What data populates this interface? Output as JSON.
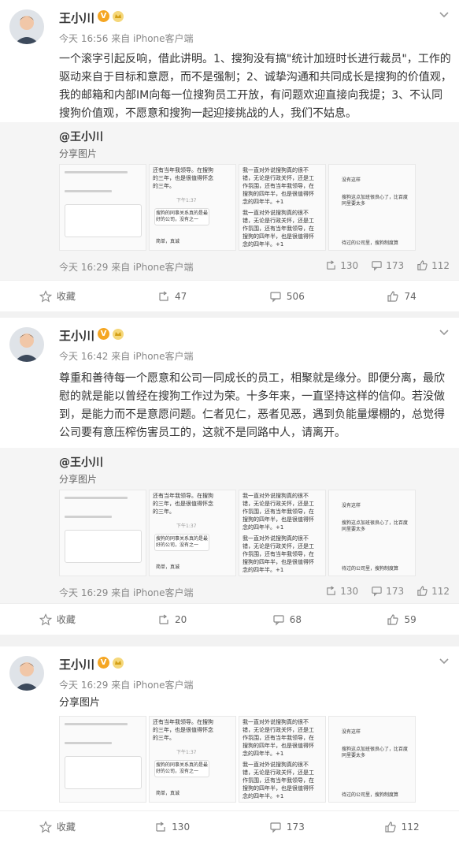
{
  "posts": [
    {
      "user": "王小川",
      "meta": "今天 16:56 来自 iPhone客户端",
      "text": "一个滚字引起反响，借此讲明。1、搜狗没有搞\"统计加班时长进行裁员\"，工作的驱动来自于目标和意愿，而不是强制；2、诚挚沟通和共同成长是搜狗的价值观，我的邮箱和内部IM向每一位搜狗员工开放，有问题欢迎直接向我提；3、不认同搜狗价值观，不愿意和搜狗一起迎接挑战的人，我们不姑息。",
      "repost": {
        "author": "@王小川",
        "share": "分享图片",
        "meta": "今天 16:29 来自 iPhone客户端",
        "forward": "130",
        "comment": "173",
        "like": "112"
      },
      "actions": {
        "fav": "收藏",
        "forward": "47",
        "comment": "506",
        "like": "74"
      }
    },
    {
      "user": "王小川",
      "meta": "今天 16:42 来自 iPhone客户端",
      "text": "尊重和善待每一个愿意和公司一同成长的员工，相聚就是缘分。即便分离，最欣慰的就是能以曾经在搜狗工作过为荣。十多年来，一直坚持这样的信仰。若没做到，是能力而不是意愿问题。仁者见仁，恶者见恶，遇到负能量爆棚的，总觉得公司要有意压榨伤害员工的，这就不是同路中人，请离开。",
      "repost": {
        "author": "@王小川",
        "share": "分享图片",
        "meta": "今天 16:29 来自 iPhone客户端",
        "forward": "130",
        "comment": "173",
        "like": "112"
      },
      "actions": {
        "fav": "收藏",
        "forward": "20",
        "comment": "68",
        "like": "59"
      }
    },
    {
      "user": "王小川",
      "meta": "今天 16:29 来自 iPhone客户端",
      "text": "分享图片",
      "actions": {
        "fav": "收藏",
        "forward": "130",
        "comment": "173",
        "like": "112"
      }
    }
  ],
  "images": {
    "t1": "还有当年我领导。在搜狗的三年，也是很值得怀念的三年。",
    "t2": "搜狗的同事关系真的是最好的公司，没有之一",
    "t3": "简单，真诚",
    "t4": "我一直对外说搜狗真的很不错，无论是行政关怀，还是工作氛围，还有当年我领导，在搜狗的四年半，也是很值得怀念的四年半。+1",
    "t5": "没有这样",
    "t6": "搜狗这点加班很良心了，比百度同里要太多",
    "t7": "待过的公司里，搜狗制度算",
    "t8": "下午1:37",
    "t9": "工作氛围，还有当年我领导。"
  },
  "colors": {
    "badge": "#f5a623",
    "link": "#333333",
    "muted": "#888888"
  },
  "icons": [
    "chevron-down-icon",
    "verified-icon",
    "crown-icon",
    "star-icon",
    "forward-icon",
    "comment-icon",
    "like-icon"
  ]
}
